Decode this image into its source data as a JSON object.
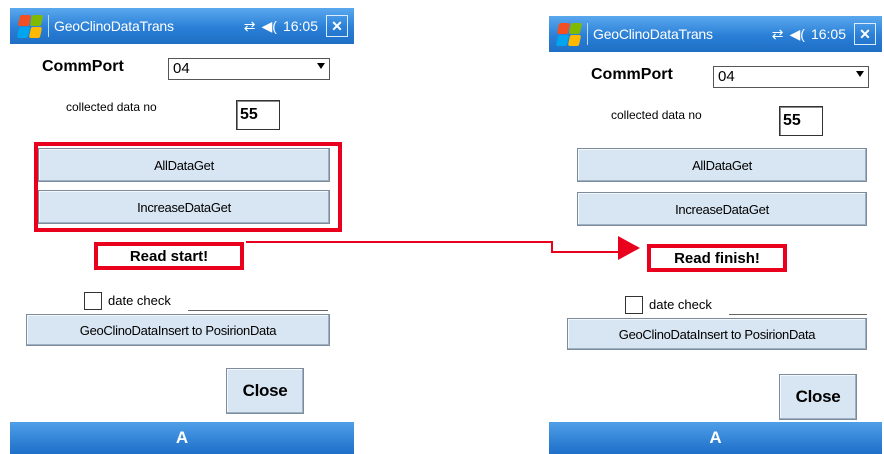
{
  "screens": [
    {
      "titlebar": {
        "title": "GeoClinoDataTrans",
        "sync_icon": "⇄",
        "volume_icon": "◀(",
        "time": "16:05",
        "close": "✕"
      },
      "commport": {
        "label": "CommPort",
        "value": "04"
      },
      "collected": {
        "label": "collected data no",
        "value": "55"
      },
      "buttons": {
        "all_data_get": "AllDataGet",
        "increase_data_get": "IncreaseDataGet",
        "insert": "GeoClinoDataInsert to PosirionData",
        "close": "Close"
      },
      "status": "Read start!",
      "date_check": {
        "label": "date check",
        "checked": false
      },
      "bottombar": "A"
    },
    {
      "titlebar": {
        "title": "GeoClinoDataTrans",
        "sync_icon": "⇄",
        "volume_icon": "◀(",
        "time": "16:05",
        "close": "✕"
      },
      "commport": {
        "label": "CommPort",
        "value": "04"
      },
      "collected": {
        "label": "collected data no",
        "value": "55"
      },
      "buttons": {
        "all_data_get": "AllDataGet",
        "increase_data_get": "IncreaseDataGet",
        "insert": "GeoClinoDataInsert to PosirionData",
        "close": "Close"
      },
      "status": "Read finish!",
      "date_check": {
        "label": "date check",
        "checked": false
      },
      "bottombar": "A"
    }
  ],
  "colors": {
    "highlight": "#e8001c",
    "titlebar": "#2a7fd6",
    "button": "#d8e6f3"
  }
}
